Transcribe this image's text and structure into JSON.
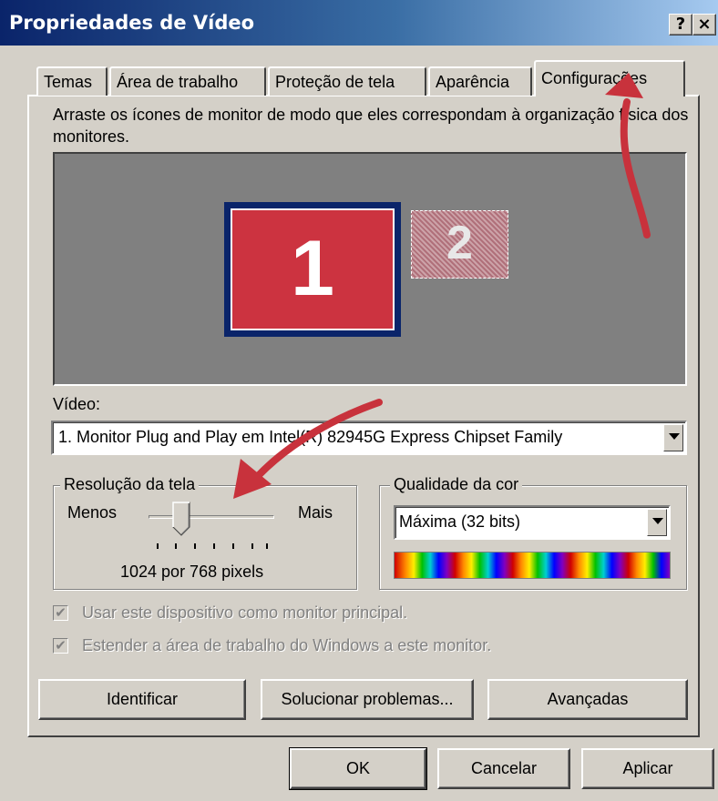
{
  "window": {
    "title": "Propriedades de Vídeo",
    "help_label": "?",
    "close_label": "×"
  },
  "tabs": [
    {
      "label": "Temas"
    },
    {
      "label": "Área de trabalho"
    },
    {
      "label": "Proteção de tela"
    },
    {
      "label": "Aparência"
    },
    {
      "label": "Configurações",
      "active": true
    }
  ],
  "instructions": "Arraste os ícones de monitor de modo que eles correspondam à organização física dos monitores.",
  "monitors": [
    {
      "label": "1",
      "color": "#cc3340",
      "selected": true
    },
    {
      "label": "2",
      "color": "#b0707a",
      "selected": false
    }
  ],
  "video": {
    "label": "Vídeo:",
    "selected": "1. Monitor Plug and Play em Intel(R) 82945G Express Chipset Family"
  },
  "resolution": {
    "group_label": "Resolução da tela",
    "less_label": "Menos",
    "more_label": "Mais",
    "value_text": "1024 por 768 pixels",
    "slider_position": 0.25
  },
  "color_quality": {
    "group_label": "Qualidade da cor",
    "selected": "Máxima (32 bits)"
  },
  "checkboxes": [
    {
      "label": "Usar este dispositivo como monitor principal.",
      "checked": true,
      "disabled": true
    },
    {
      "label": "Estender a área de trabalho do Windows a este monitor.",
      "checked": true,
      "disabled": true
    }
  ],
  "buttons": {
    "identify": "Identificar",
    "troubleshoot": "Solucionar problemas...",
    "advanced": "Avançadas",
    "ok": "OK",
    "cancel": "Cancelar",
    "apply": "Aplicar"
  },
  "annotation_color": "#c8323c"
}
